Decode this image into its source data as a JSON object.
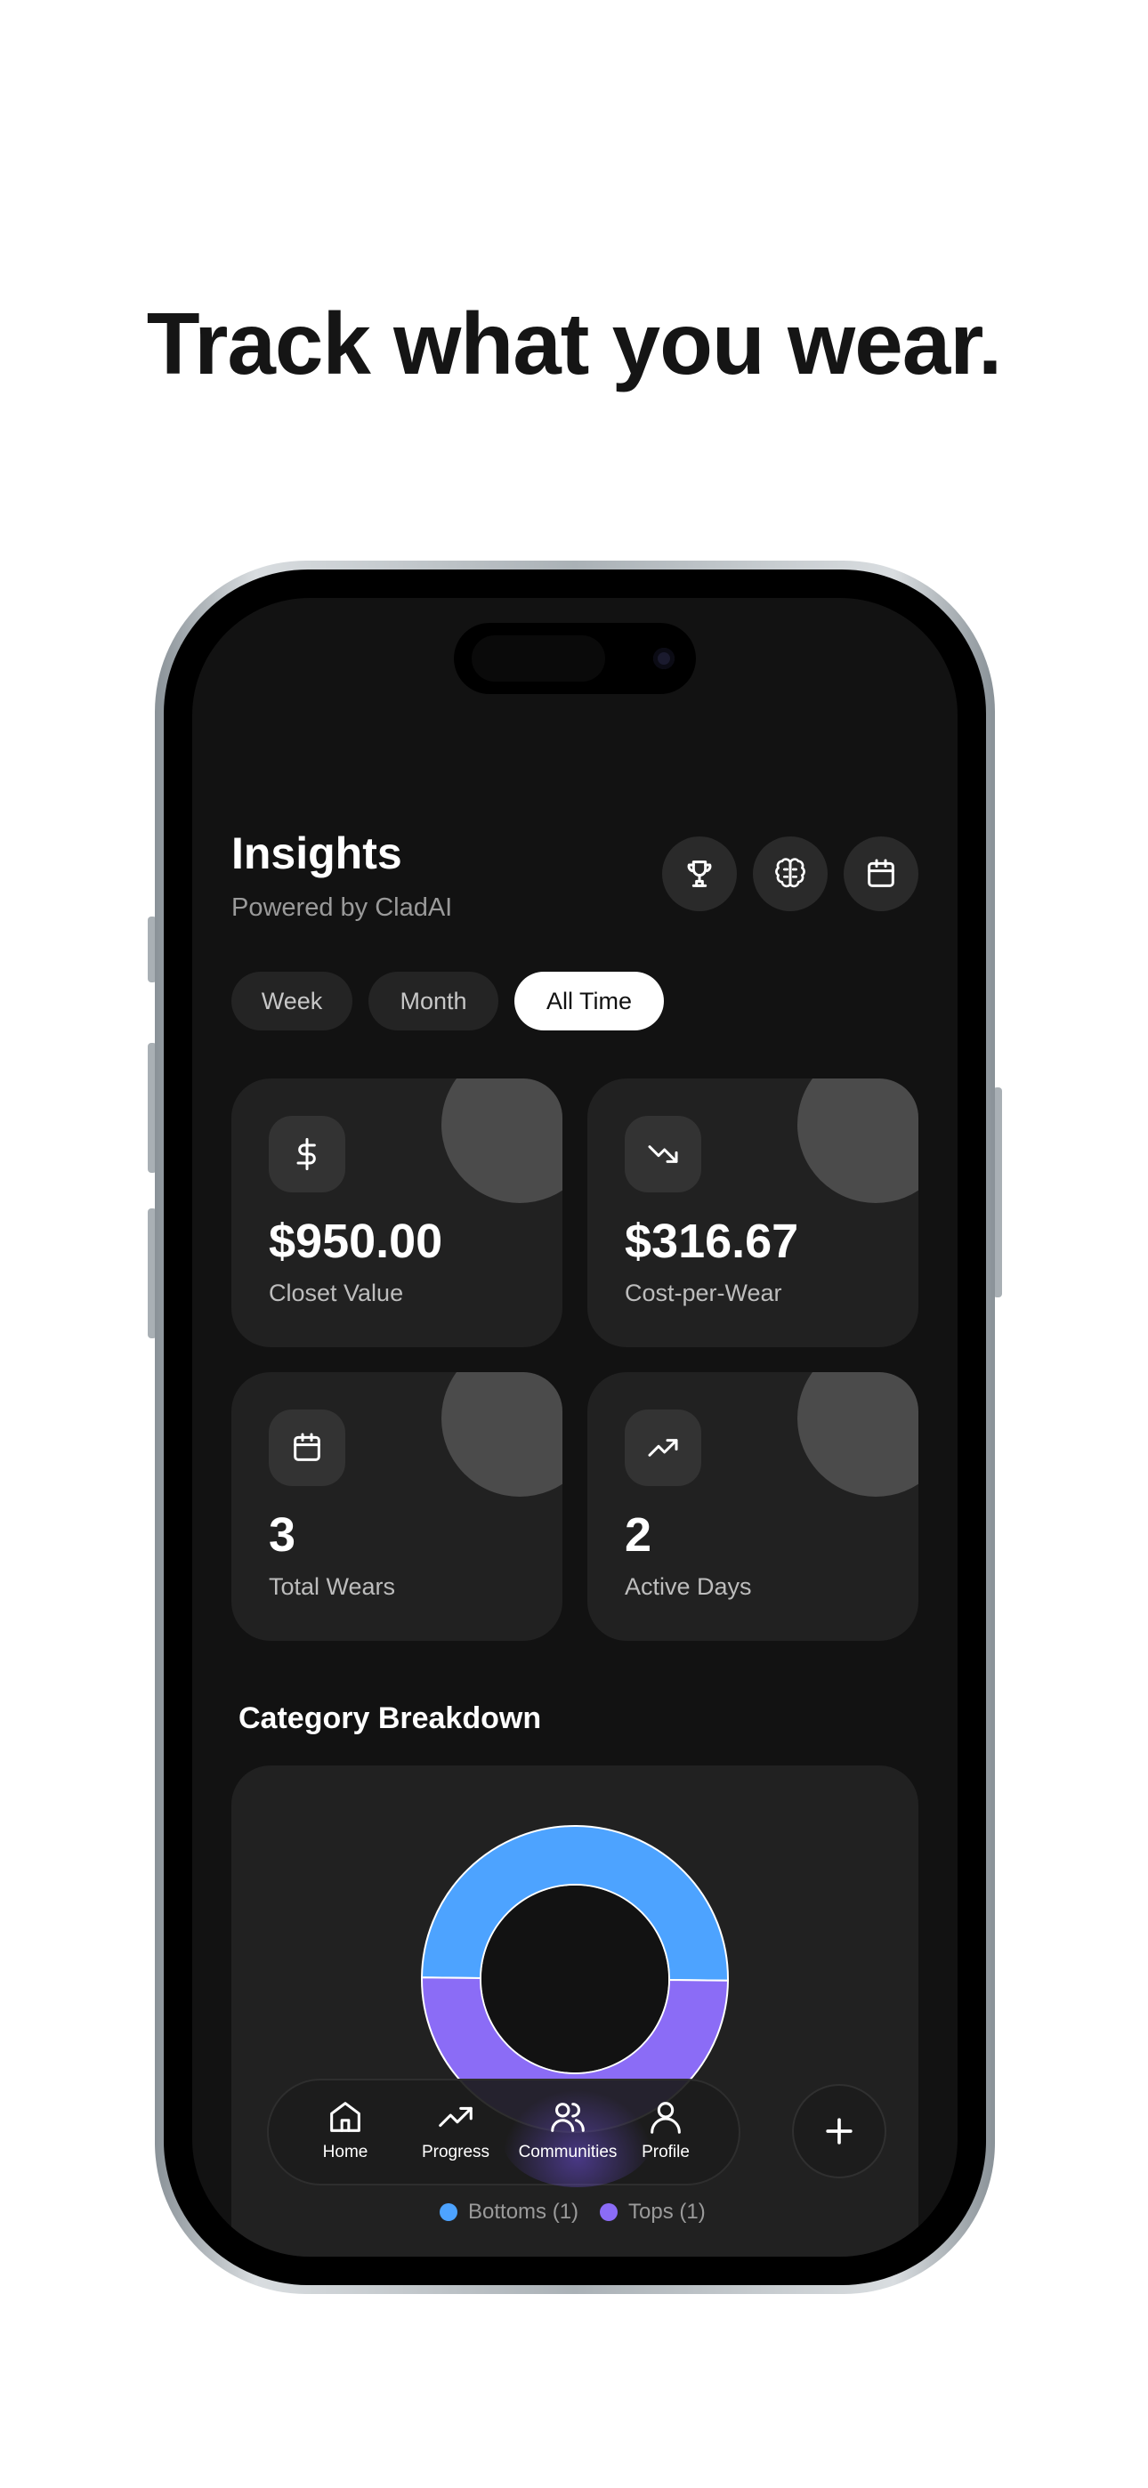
{
  "headline": "Track what you wear.",
  "header": {
    "title": "Insights",
    "subtitle": "Powered by CladAI"
  },
  "header_icons": [
    "trophy-icon",
    "brain-icon",
    "calendar-icon"
  ],
  "period_tabs": [
    {
      "label": "Week",
      "active": false
    },
    {
      "label": "Month",
      "active": false
    },
    {
      "label": "All Time",
      "active": true
    }
  ],
  "stats": [
    {
      "value": "$950.00",
      "label": "Closet Value",
      "icon": "dollar-icon"
    },
    {
      "value": "$316.67",
      "label": "Cost-per-Wear",
      "icon": "trending-down-icon"
    },
    {
      "value": "3",
      "label": "Total Wears",
      "icon": "calendar-icon"
    },
    {
      "value": "2",
      "label": "Active Days",
      "icon": "trending-up-icon"
    }
  ],
  "category_breakdown": {
    "title": "Category Breakdown",
    "legend": [
      {
        "label": "Bottoms (1)",
        "color": "#4da3ff"
      },
      {
        "label": "Tops (1)",
        "color": "#8b6cf6"
      }
    ]
  },
  "chart_data": {
    "type": "pie",
    "categories": [
      "Bottoms",
      "Tops"
    ],
    "values": [
      1,
      1
    ],
    "colors": [
      "#4da3ff",
      "#8b6cf6"
    ]
  },
  "nav": {
    "items": [
      {
        "label": "Home",
        "icon": "home-icon"
      },
      {
        "label": "Progress",
        "icon": "trending-up-icon"
      },
      {
        "label": "Communities",
        "icon": "users-icon"
      },
      {
        "label": "Profile",
        "icon": "user-icon"
      }
    ],
    "active": "Communities"
  },
  "colors": {
    "accent_blue": "#4da3ff",
    "accent_purple": "#8b6cf6",
    "background": "#121212",
    "card": "#212121"
  }
}
